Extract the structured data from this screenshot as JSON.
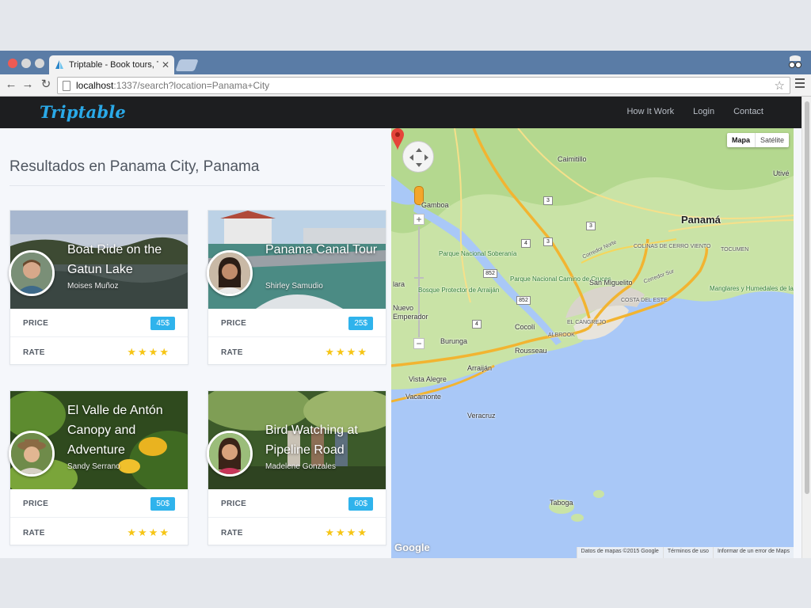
{
  "browser": {
    "tab_title": "Triptable - Book tours, Thi",
    "url_host": "localhost",
    "url_rest": ":1337/search?location=Panama+City"
  },
  "site": {
    "logo": "Triptable",
    "nav": [
      "How It Work",
      "Login",
      "Contact"
    ]
  },
  "results": {
    "title": "Resultados en Panama City, Panama",
    "price_label": "PRICE",
    "rate_label": "RATE",
    "stars": "★★★★",
    "cards": [
      {
        "title": "Boat Ride on the Gatun Lake",
        "author": "Moises Muñoz",
        "price": "45$",
        "rating": 4
      },
      {
        "title": "Panama Canal Tour",
        "author": "Shirley Samudio",
        "price": "25$",
        "rating": 4
      },
      {
        "title": "El Valle de Antón Canopy and Adventure",
        "author": "Sandy Serrano",
        "price": "50$",
        "rating": 4
      },
      {
        "title": "Bird Watching at Pipeline Road",
        "author": "Madelene Gonzales",
        "price": "60$",
        "rating": 4
      }
    ]
  },
  "map": {
    "type_buttons": [
      "Mapa",
      "Satélite"
    ],
    "zoom_plus": "+",
    "zoom_minus": "−",
    "places": {
      "caimitillo": "Caimitillo",
      "utive": "Utivé",
      "panama": "Panamá",
      "gamboa": "Gamboa",
      "parque_soberania": "Parque Nacional Soberanía",
      "colinas": "COLINAS DE CERRO VIENTO",
      "tocumen": "TOCUMEN",
      "corredor_norte": "Corredor Norte",
      "corredor_sur": "Corredor Sur",
      "camino_cruces": "Parque Nacional Camino de Cruces",
      "san_miguelito": "San Miguelito",
      "costa_este": "COSTA DEL ESTE",
      "manglares": "Manglares y Humedales de la Bahía de Panamá",
      "nuevo_emperador": "Nuevo Emperador",
      "bosque_arraijan": "Bosque Protector de Arraiján",
      "cocoli": "Cocolí",
      "albrook": "ALBROOK",
      "el_cangrejo": "EL CANGREJO",
      "burunga": "Burunga",
      "rousseau": "Rousseau",
      "arraijan": "Arraiján",
      "vista_alegre": "Vista Alegre",
      "vacamonte": "Vacamonte",
      "veracruz": "Veracruz",
      "taboga": "Taboga",
      "laara": "lara"
    },
    "routes": [
      "3",
      "3",
      "852",
      "4",
      "852",
      "4",
      "3"
    ],
    "google": "Google",
    "attribution": [
      "Datos de mapas ©2015 Google",
      "Términos de uso",
      "Informar de un error de Maps"
    ]
  }
}
